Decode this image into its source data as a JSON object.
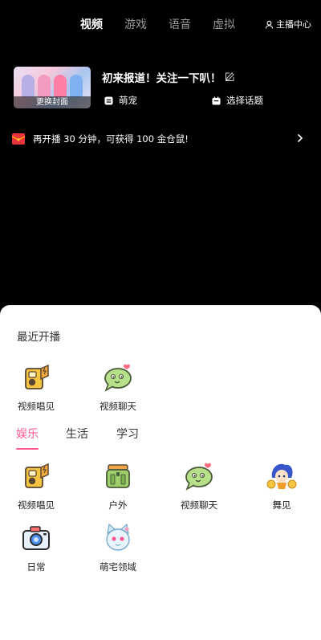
{
  "top_tabs": [
    "视频",
    "游戏",
    "语音",
    "虚拟"
  ],
  "active_tab": "视频",
  "anchor_center_label": "主播中心",
  "stream": {
    "cover_button": "更换封面",
    "title": "初来报道！关注一下叭！",
    "category": "萌宠",
    "topic_label": "选择话题"
  },
  "promo_text": "再开播 30 分钟，可获得 100 金仓鼠!",
  "recent": {
    "title": "最近开播",
    "items": [
      {
        "label": "视频唱见",
        "icon": "video-singing-icon"
      },
      {
        "label": "视频聊天",
        "icon": "video-chat-icon"
      }
    ]
  },
  "categories": {
    "tabs": [
      "娱乐",
      "生活",
      "学习"
    ],
    "active": "娱乐",
    "items": [
      {
        "label": "视频唱见",
        "icon": "video-singing-icon"
      },
      {
        "label": "户外",
        "icon": "outdoor-backpack-icon"
      },
      {
        "label": "视频聊天",
        "icon": "video-chat-icon"
      },
      {
        "label": "舞见",
        "icon": "dance-icon"
      },
      {
        "label": "日常",
        "icon": "camera-icon"
      },
      {
        "label": "萌宅领域",
        "icon": "otaku-cat-icon"
      }
    ]
  },
  "colors": {
    "accent": "#ff5a95",
    "background": "#000000",
    "sheet": "#ffffff"
  }
}
